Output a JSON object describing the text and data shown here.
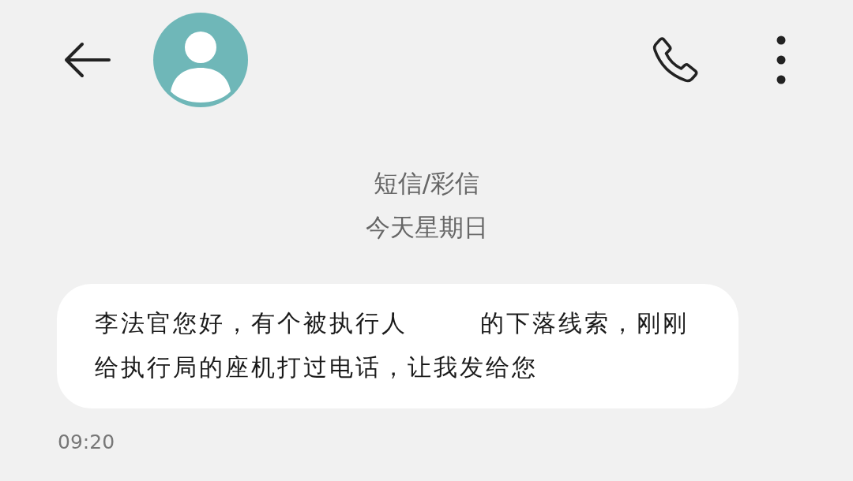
{
  "header": {
    "service": "短信/彩信",
    "day": "今天星期日"
  },
  "message": {
    "before": "李法官您好，有个被执行人",
    "redacted": true,
    "after": "的下落线索，刚刚给执行局的座机打过电话，让我发给您",
    "time": "09:20"
  }
}
